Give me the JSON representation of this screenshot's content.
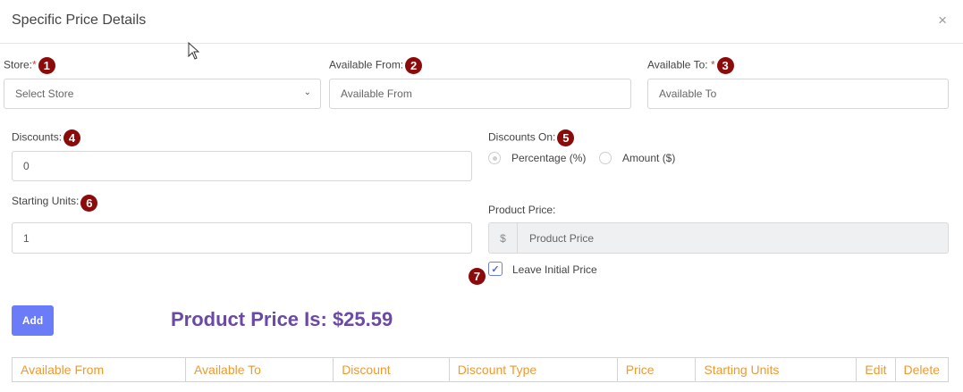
{
  "modal": {
    "title": "Specific Price Details",
    "close_glyph": "×"
  },
  "callouts": [
    "1",
    "2",
    "3",
    "4",
    "5",
    "6",
    "7"
  ],
  "store": {
    "label": "Store:",
    "required_mark": "*",
    "value": "Select Store"
  },
  "available_from": {
    "label": "Available From:",
    "placeholder": "Available From"
  },
  "available_to": {
    "label": "Available To:",
    "required_mark": "*",
    "placeholder": "Available To"
  },
  "discounts": {
    "label": "Discounts:",
    "value": "0"
  },
  "discounts_on": {
    "label": "Discounts On:",
    "options": [
      "Percentage (%)",
      "Amount ($)"
    ],
    "selected": "Percentage (%)"
  },
  "starting_units": {
    "label": "Starting Units:",
    "value": "1"
  },
  "product_price": {
    "label": "Product Price:",
    "addon": "$",
    "placeholder": "Product Price"
  },
  "leave_initial_price": {
    "label": "Leave Initial Price",
    "checked": true
  },
  "add_button": {
    "label": "Add"
  },
  "product_price_message": "Product Price Is: $25.59",
  "table": {
    "headers": [
      "Available From",
      "Available To",
      "Discount",
      "Discount Type",
      "Price",
      "Starting Units",
      "Edit",
      "Delete"
    ]
  },
  "colors": {
    "callout": "#8b0a0a",
    "add_button": "#6a7cf7",
    "price_message": "#6b49a8",
    "table_header": "#ee9a2f",
    "required": "#e23b3b"
  }
}
